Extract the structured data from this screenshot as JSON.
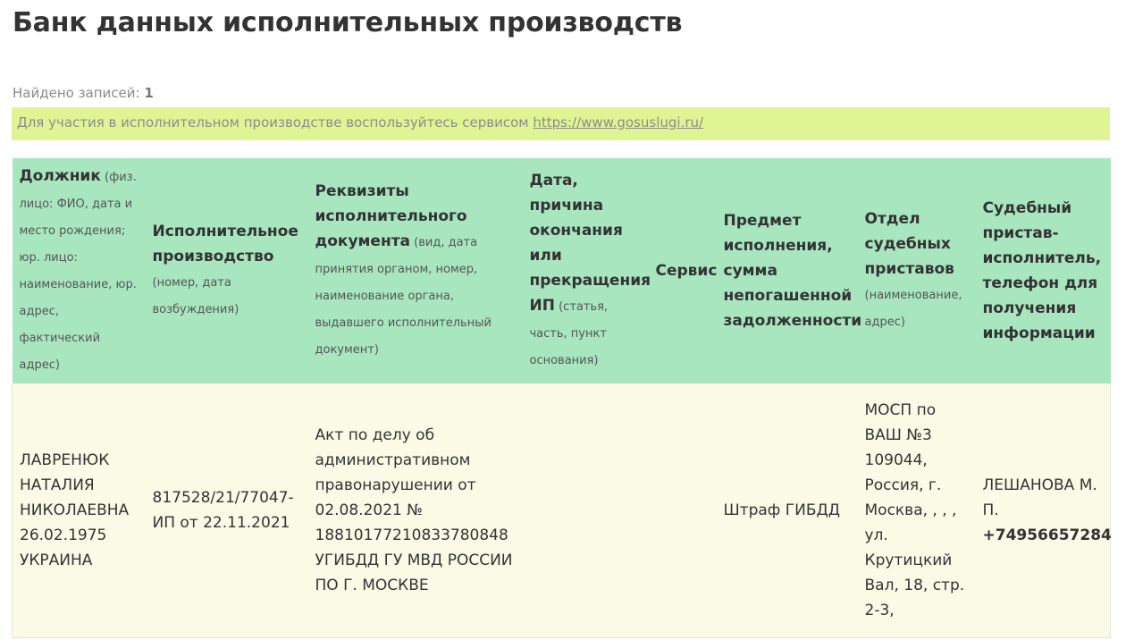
{
  "page": {
    "title": "Банк данных исполнительных производств"
  },
  "results": {
    "found_label": "Найдено записей:",
    "found_count": "1"
  },
  "notice": {
    "text": "Для участия в исполнительном производстве воспользуйтесь сервисом ",
    "link_text": "https://www.gosuslugi.ru/"
  },
  "table": {
    "headers": [
      {
        "title": "Должник",
        "sub": " (физ. лицо: ФИО, дата и место рождения; юр. лицо: наименование, юр. адрес, фактический адрес)"
      },
      {
        "title": "Исполнительное производство",
        "sub": "(номер, дата возбуждения)"
      },
      {
        "title": "Реквизиты исполнительного документа",
        "sub": " (вид, дата принятия органом, номер, наименование органа, выдавшего исполнительный документ)"
      },
      {
        "title": "Дата, причина окончания или прекращения ИП",
        "sub": " (статья, часть, пункт основания)"
      },
      {
        "title": "Сервис",
        "sub": ""
      },
      {
        "title": "Предмет исполнения, сумма непогашенной задолженности",
        "sub": ""
      },
      {
        "title": "Отдел судебных приставов",
        "sub": "(наименование, адрес)"
      },
      {
        "title": "Судебный пристав-исполнитель, телефон для получения информации",
        "sub": ""
      }
    ],
    "rows": [
      {
        "debtor": [
          "ЛАВРЕНЮК",
          "НАТАЛИЯ",
          "НИКОЛАЕВНА",
          "26.02.1975",
          "УКРАИНА"
        ],
        "proceeding": "817528/21/77047-ИП от 22.11.2021",
        "document": "Акт по делу об административном правонарушении от 02.08.2021 № 18810177210833780848 УГИБДД ГУ МВД РОССИИ ПО Г. МОСКВЕ",
        "end_info": "",
        "service": "",
        "subject": "Штраф ГИБДД",
        "department": "МОСП по ВАШ №3 109044, Россия, г. Москва, , , , ул. Крутицкий Вал, 18, стр. 2-3,",
        "bailiff": "ЛЕШАНОВА М. П.",
        "phone": "+74956657284"
      }
    ]
  }
}
